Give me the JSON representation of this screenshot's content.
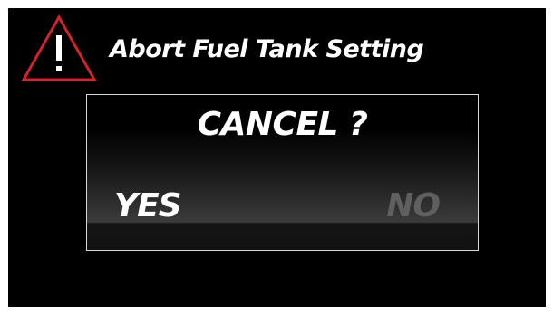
{
  "alert": {
    "icon": "warning-triangle-icon",
    "icon_color": "#d2232a",
    "title": "Abort Fuel Tank Setting"
  },
  "dialog": {
    "question": "CANCEL ?",
    "options": [
      {
        "label": "YES",
        "selected": true
      },
      {
        "label": "NO",
        "selected": false
      }
    ]
  }
}
